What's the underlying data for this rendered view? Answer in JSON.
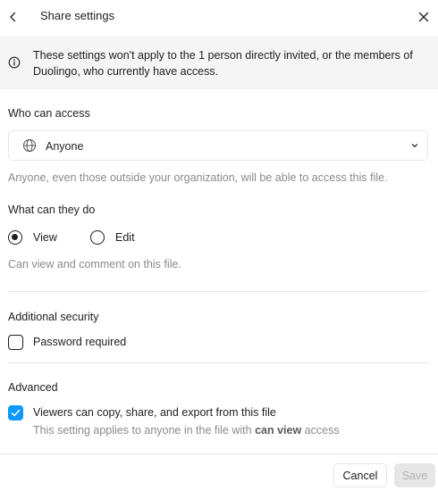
{
  "header": {
    "title": "Share settings",
    "back_icon": "chevron-left-icon",
    "close_icon": "close-icon"
  },
  "notice": {
    "icon": "info-icon",
    "text": "These settings won't apply to the 1 person directly invited, or the members of Duolingo, who currently have access."
  },
  "who_can_access": {
    "label": "Who can access",
    "selected": "Anyone",
    "icon": "globe-icon",
    "helper": "Anyone, even those outside your organization, will be able to access this file."
  },
  "what_can_they_do": {
    "label": "What can they do",
    "options": [
      {
        "label": "View",
        "checked": true
      },
      {
        "label": "Edit",
        "checked": false
      }
    ],
    "helper": "Can view and comment on this file."
  },
  "additional_security": {
    "label": "Additional security",
    "password_label": "Password required",
    "password_checked": false
  },
  "advanced": {
    "label": "Advanced",
    "viewers_label": "Viewers can copy, share, and export from this file",
    "viewers_checked": true,
    "helper_prefix": "This setting applies to anyone in the file with ",
    "helper_bold": "can view",
    "helper_suffix": " access"
  },
  "footer": {
    "cancel_label": "Cancel",
    "save_label": "Save"
  },
  "colors": {
    "accent": "#0d99ff",
    "notice_bg": "#f5f5f5",
    "muted_text": "#8a8a8a",
    "border": "#e6e6e6"
  }
}
